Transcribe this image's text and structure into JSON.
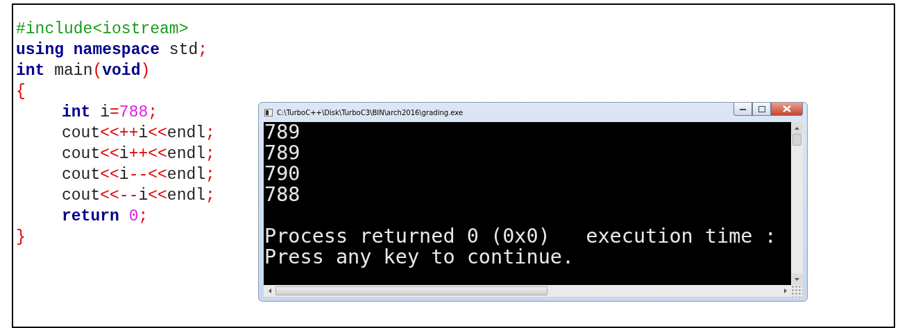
{
  "code": {
    "lines": [
      {
        "tokens": [
          {
            "kind": "preprocessor",
            "text": "#include<iostream>"
          }
        ]
      },
      {
        "tokens": [
          {
            "kind": "keyword",
            "text": "using"
          },
          {
            "kind": "keyword",
            "text": " namespace"
          },
          {
            "kind": "plain",
            "text": " std"
          },
          {
            "kind": "operator",
            "text": ";"
          }
        ]
      },
      {
        "tokens": [
          {
            "kind": "keyword",
            "text": "int"
          },
          {
            "kind": "plain",
            "text": " main"
          },
          {
            "kind": "operator",
            "text": "("
          },
          {
            "kind": "keyword",
            "text": "void"
          },
          {
            "kind": "operator",
            "text": ")"
          }
        ]
      },
      {
        "tokens": [
          {
            "kind": "operator",
            "text": "{"
          }
        ],
        "children": [
          {
            "tokens": [
              {
                "kind": "keyword",
                "text": "int"
              },
              {
                "kind": "plain",
                "text": " i"
              },
              {
                "kind": "operator",
                "text": "="
              },
              {
                "kind": "number",
                "text": "788"
              },
              {
                "kind": "operator",
                "text": ";"
              }
            ]
          },
          {
            "tokens": [
              {
                "kind": "plain",
                "text": "cout"
              },
              {
                "kind": "operator",
                "text": "<<++"
              },
              {
                "kind": "plain",
                "text": "i"
              },
              {
                "kind": "operator",
                "text": "<<"
              },
              {
                "kind": "plain",
                "text": "endl"
              },
              {
                "kind": "operator",
                "text": ";"
              }
            ]
          },
          {
            "tokens": [
              {
                "kind": "plain",
                "text": "cout"
              },
              {
                "kind": "operator",
                "text": "<<"
              },
              {
                "kind": "plain",
                "text": "i"
              },
              {
                "kind": "operator",
                "text": "++<<"
              },
              {
                "kind": "plain",
                "text": "endl"
              },
              {
                "kind": "operator",
                "text": ";"
              }
            ]
          },
          {
            "tokens": [
              {
                "kind": "plain",
                "text": "cout"
              },
              {
                "kind": "operator",
                "text": "<<"
              },
              {
                "kind": "plain",
                "text": "i"
              },
              {
                "kind": "operator",
                "text": "--<<"
              },
              {
                "kind": "plain",
                "text": "endl"
              },
              {
                "kind": "operator",
                "text": ";"
              }
            ]
          },
          {
            "tokens": [
              {
                "kind": "plain",
                "text": "cout"
              },
              {
                "kind": "operator",
                "text": "<<--"
              },
              {
                "kind": "plain",
                "text": "i"
              },
              {
                "kind": "operator",
                "text": "<<"
              },
              {
                "kind": "plain",
                "text": "endl"
              },
              {
                "kind": "operator",
                "text": ";"
              }
            ]
          },
          {
            "tokens": [
              {
                "kind": "keyword",
                "text": "return"
              },
              {
                "kind": "number",
                "text": " 0"
              },
              {
                "kind": "operator",
                "text": ";"
              }
            ]
          }
        ]
      },
      {
        "tokens": [
          {
            "kind": "operator",
            "text": "}"
          }
        ]
      }
    ]
  },
  "console_window": {
    "title": "C:\\TurboC++\\Disk\\TurboC3\\BIN\\arch2016\\grading.exe",
    "output_blocks": [
      [
        "789",
        "789",
        "790",
        "788"
      ],
      [
        "Process returned 0 (0x0)   execution time :",
        "Press any key to continue."
      ]
    ]
  }
}
